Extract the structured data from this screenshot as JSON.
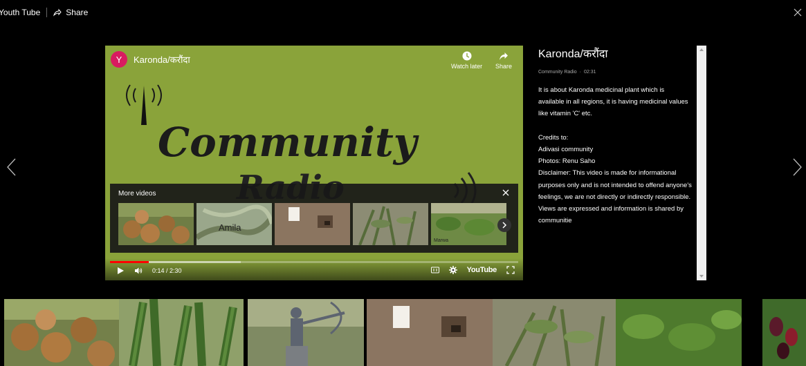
{
  "topbar": {
    "site_title": "Youth Tube",
    "share_label": "Share"
  },
  "player": {
    "channel_initial": "Y",
    "video_title": "Karonda/करौंदा",
    "watch_later_label": "Watch later",
    "share_label": "Share",
    "title_art_line1": "Community",
    "title_art_line2": "Radio",
    "more_videos_label": "More videos",
    "more_thumbs": [
      {
        "caption": ""
      },
      {
        "caption": "Amila"
      },
      {
        "caption": ""
      },
      {
        "caption": ""
      },
      {
        "caption": "Marwa"
      }
    ],
    "time": "0:14 / 2:30",
    "progress_played": 0.095,
    "progress_buffered": 0.32,
    "youtube_label": "YouTube"
  },
  "details": {
    "title": "Karonda/करौंदा",
    "source": "Community Radio",
    "separator": "·",
    "duration": "02:31",
    "description": "It is about Karonda medicinal plant which is available in all regions, it is having medicinal values like vitamin 'C' etc.\n\nCredits to:\n Adivasi community\nPhotos: Renu Saho\nDisclaimer: This video is made for informational purposes only and is not intended to offend anyone's feelings, we are not directly or indirectly responsible. Views are expressed and information is shared by communitie"
  },
  "filmstrip": [
    {
      "subject": "karonda-fruits"
    },
    {
      "subject": "aloe-plants"
    },
    {
      "subject": "archer-statue"
    },
    {
      "subject": "mud-wall-niche"
    },
    {
      "subject": "herb-plant"
    },
    {
      "subject": "green-shrub"
    },
    {
      "subject": "mulberries"
    }
  ],
  "colors": {
    "player_bg": "#8aa33a",
    "progress_red": "#ff0000",
    "avatar": "#d81b60"
  }
}
